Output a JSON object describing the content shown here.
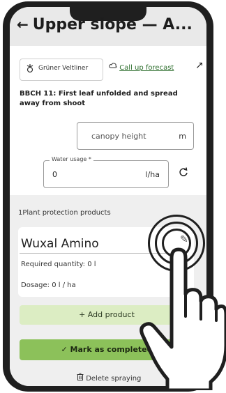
{
  "header": {
    "back_glyph": "←",
    "title": "Upper slope — A..."
  },
  "variety": {
    "icon": "grape-icon",
    "label": "Grüner Veltliner"
  },
  "forecast": {
    "icon": "cloud-icon",
    "link_text": "Call up forecast",
    "arrow": "↗"
  },
  "bbch": {
    "text": "BBCH 11: First leaf unfolded and spread away from shoot"
  },
  "canopy": {
    "placeholder": "canopy height",
    "unit": "m"
  },
  "water": {
    "legend": "Water usage *",
    "value": "0",
    "unit": "l/ha"
  },
  "products": {
    "section_label": "1Plant protection products",
    "items": [
      {
        "name": "Wuxal Amino",
        "quantity": "Required quantity: 0 l",
        "dosage": "Dosage: 0 l / ha"
      }
    ]
  },
  "actions": {
    "add_label": "+ Add product",
    "mark_label": "✓ Mark as completed",
    "delete_label": "Delete spraying"
  },
  "colors": {
    "add_bg": "#dcedc3",
    "mark_bg": "#8cc15a",
    "section_bg": "#efefef",
    "phone_frame": "#1f1f1f"
  }
}
